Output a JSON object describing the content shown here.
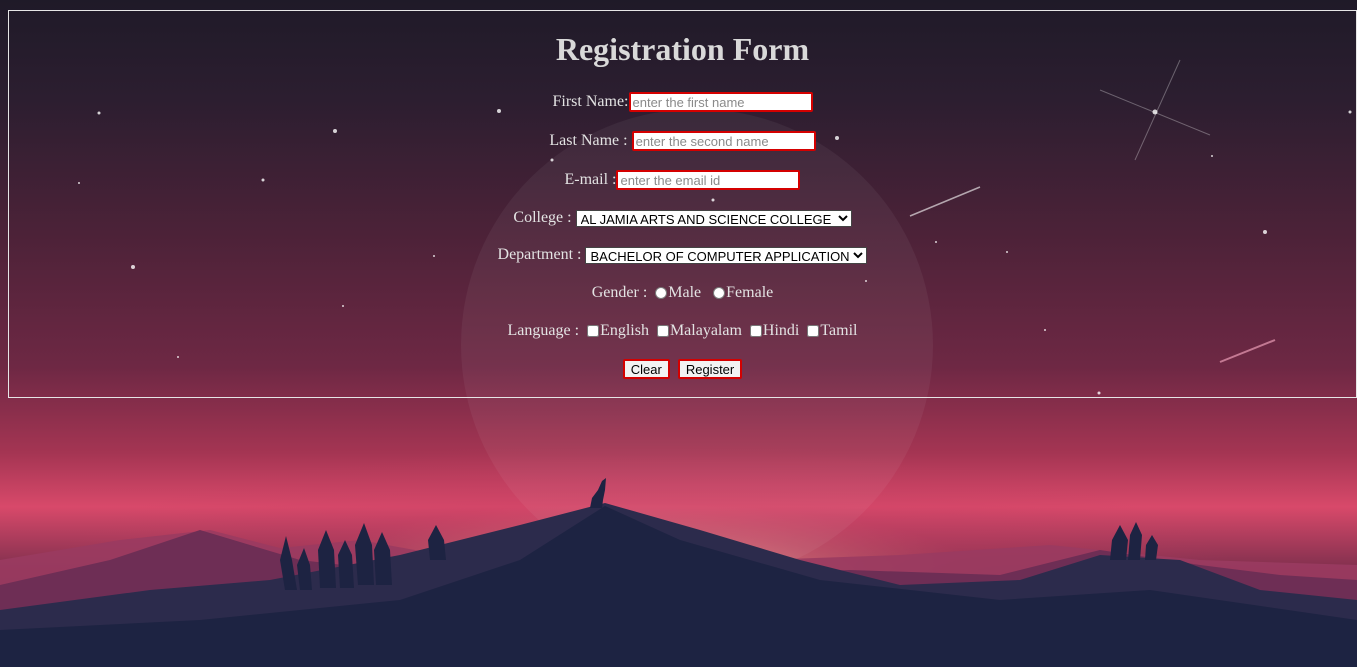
{
  "form": {
    "title": "Registration Form",
    "first_name_label": "First Name:",
    "first_name_placeholder": "enter the first name",
    "last_name_label": "Last Name :",
    "last_name_placeholder": "enter the second name",
    "email_label": "E-mail :",
    "email_placeholder": "enter the email id",
    "college_label": "College :",
    "college_selected": "AL JAMIA ARTS AND SCIENCE COLLEGE",
    "department_label": "Department :",
    "department_selected": "BACHELOR OF COMPUTER APPLICATION",
    "gender_label": "Gender :",
    "gender_options": [
      "Male",
      "Female"
    ],
    "language_label": "Language :",
    "language_options": [
      "English",
      "Malayalam",
      "Hindi",
      "Tamil"
    ],
    "clear_label": "Clear",
    "register_label": "Register"
  }
}
